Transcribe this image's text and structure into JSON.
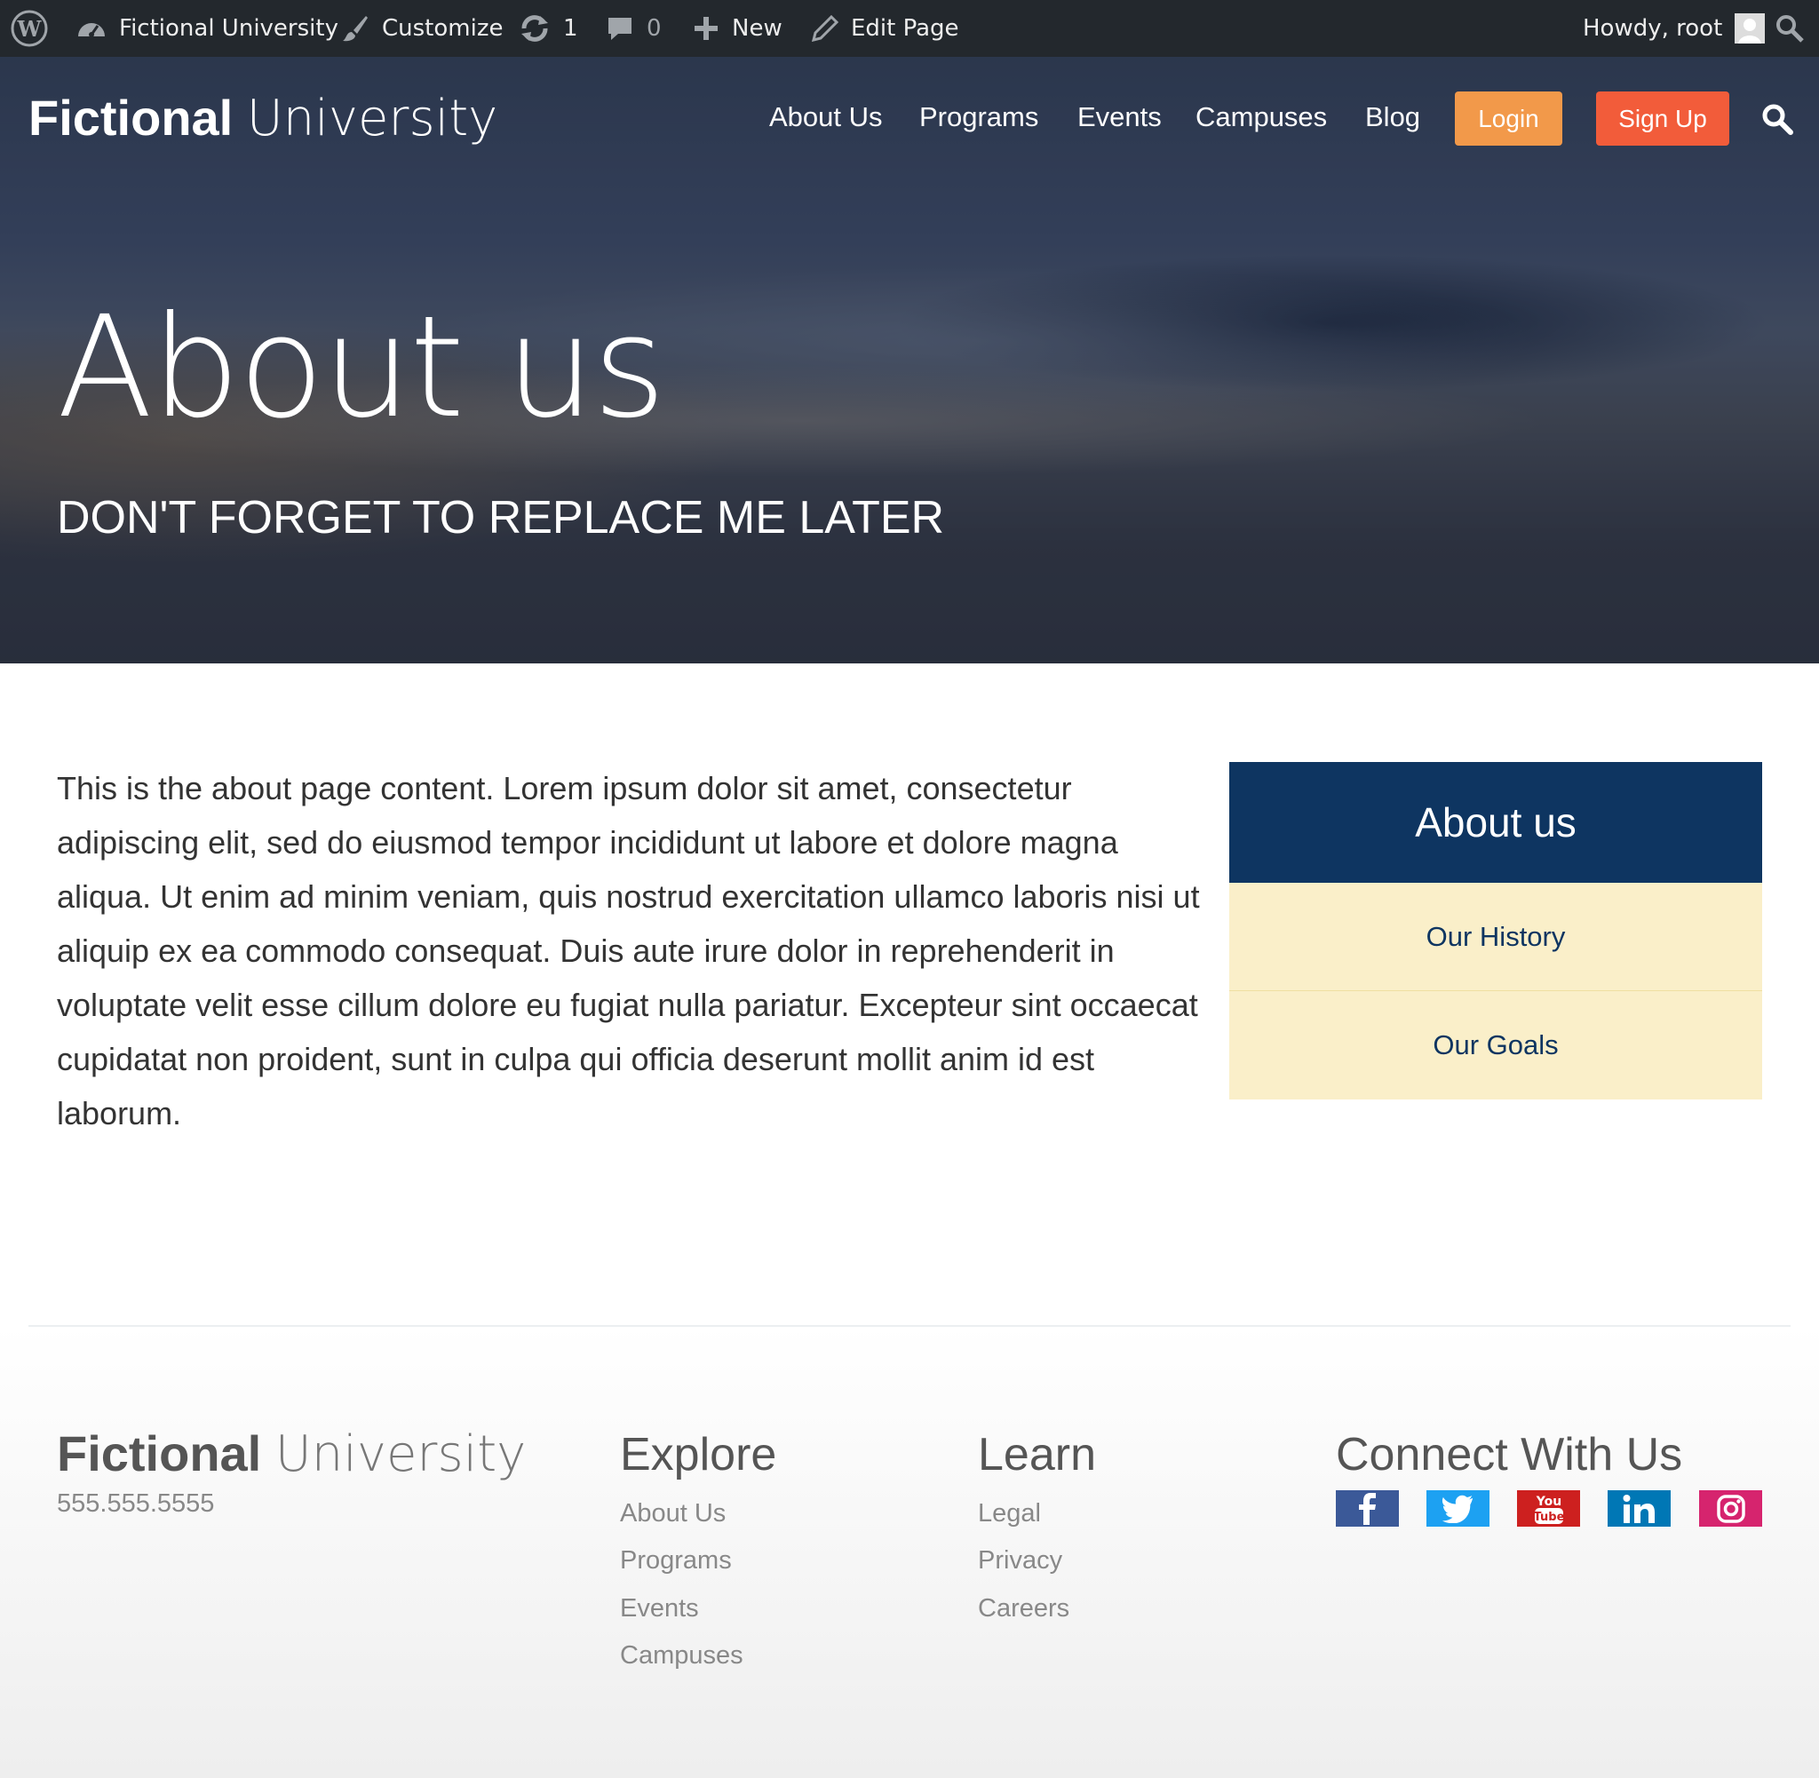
{
  "admin_bar": {
    "site_name": "Fictional University",
    "customize": "Customize",
    "updates_count": "1",
    "comments_count": "0",
    "new_label": "New",
    "edit_page": "Edit Page",
    "howdy": "Howdy, root"
  },
  "header": {
    "logo_bold": "Fictional",
    "logo_light": "University",
    "nav": [
      "About Us",
      "Programs",
      "Events",
      "Campuses",
      "Blog"
    ],
    "login_label": "Login",
    "signup_label": "Sign Up"
  },
  "hero": {
    "title": "About us",
    "subtitle": "DON'T FORGET TO REPLACE ME LATER"
  },
  "content": {
    "body": "This is the about page content. Lorem ipsum dolor sit amet, consectetur adipiscing elit, sed do eiusmod tempor incididunt ut labore et dolore magna aliqua. Ut enim ad minim veniam, quis nostrud exercitation ullamco laboris nisi ut aliquip ex ea commodo consequat. Duis aute irure dolor in reprehenderit in voluptate velit esse cillum dolore eu fugiat nulla pariatur. Excepteur sint occaecat cupidatat non proident, sunt in culpa qui officia deserunt mollit anim id est laborum."
  },
  "sidebar": {
    "title": "About us",
    "items": [
      "Our History",
      "Our Goals"
    ]
  },
  "footer": {
    "logo_bold": "Fictional",
    "logo_light": "University",
    "phone": "555.555.5555",
    "explore": {
      "heading": "Explore",
      "links": [
        "About Us",
        "Programs",
        "Events",
        "Campuses"
      ]
    },
    "learn": {
      "heading": "Learn",
      "links": [
        "Legal",
        "Privacy",
        "Careers"
      ]
    },
    "connect": {
      "heading": "Connect With Us",
      "icons": [
        "facebook-icon",
        "twitter-icon",
        "youtube-icon",
        "linkedin-icon",
        "instagram-icon"
      ]
    }
  },
  "colors": {
    "admin_bar": "#23282d",
    "login": "#f2994a",
    "signup": "#f25c3a",
    "sidebar_head": "#0e3561",
    "sidebar_item": "#faefc9"
  }
}
